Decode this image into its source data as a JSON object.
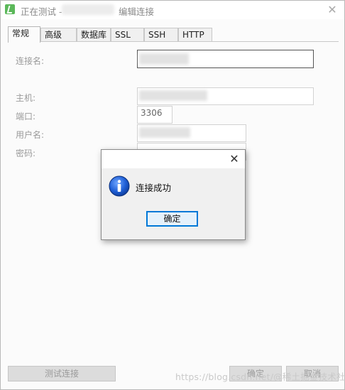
{
  "window": {
    "title_prefix": "正在测试 -",
    "title_suffix": "编辑连接",
    "close_glyph": "✕"
  },
  "tabs": [
    {
      "label": "常规",
      "active": true
    },
    {
      "label": "高级"
    },
    {
      "label": "数据库"
    },
    {
      "label": "SSL"
    },
    {
      "label": "SSH"
    },
    {
      "label": "HTTP"
    }
  ],
  "form": {
    "connection_name_label": "连接名:",
    "host_label": "主机:",
    "port_label": "端口:",
    "port_value": "3306",
    "username_label": "用户名:",
    "password_label": "密码:"
  },
  "dialog": {
    "close_glyph": "✕",
    "icon": "info-icon",
    "message": "连接成功",
    "ok_label": "确定"
  },
  "buttons": {
    "test_connection": "测试连接",
    "ok": "确定",
    "cancel": "取消"
  },
  "watermark": "https://blog.csdn.net/@稀土掘金技术社区"
}
